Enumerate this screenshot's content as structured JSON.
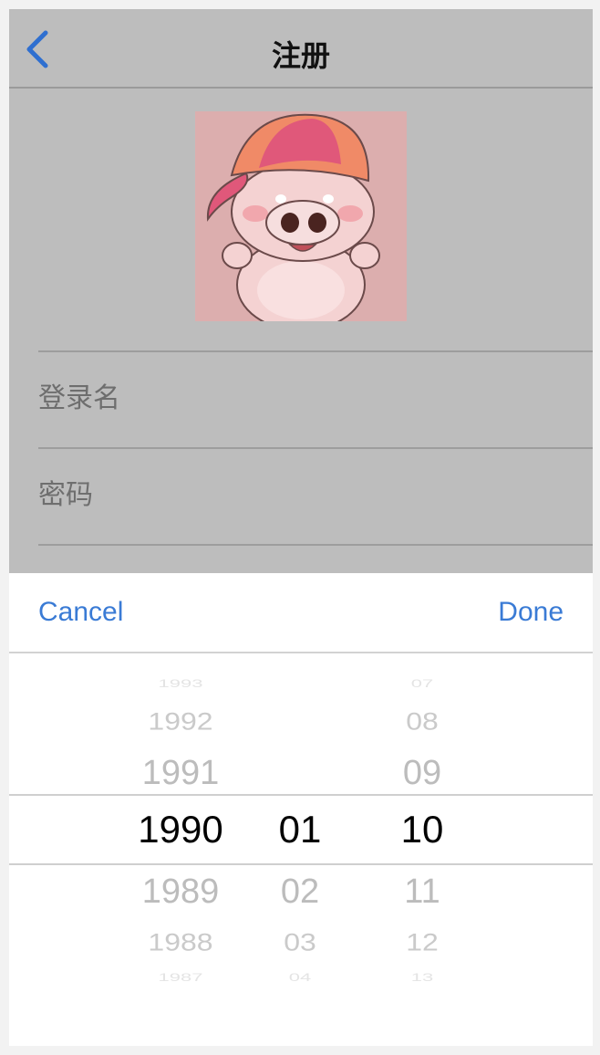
{
  "navbar": {
    "title": "注册",
    "back_icon": "chevron-left-icon",
    "accent_color": "#2f6fd0"
  },
  "form": {
    "username_placeholder": "登录名",
    "password_placeholder": "密码"
  },
  "picker_sheet": {
    "cancel_label": "Cancel",
    "done_label": "Done",
    "button_color": "#3a7bd5",
    "years": [
      "1993",
      "1992",
      "1991",
      "1990",
      "1989",
      "1988",
      "1987"
    ],
    "months": [
      "01",
      "02",
      "03",
      "04"
    ],
    "days": [
      "07",
      "08",
      "09",
      "10",
      "11",
      "12",
      "13"
    ],
    "selected": {
      "year": "1990",
      "month": "01",
      "day": "10"
    }
  }
}
